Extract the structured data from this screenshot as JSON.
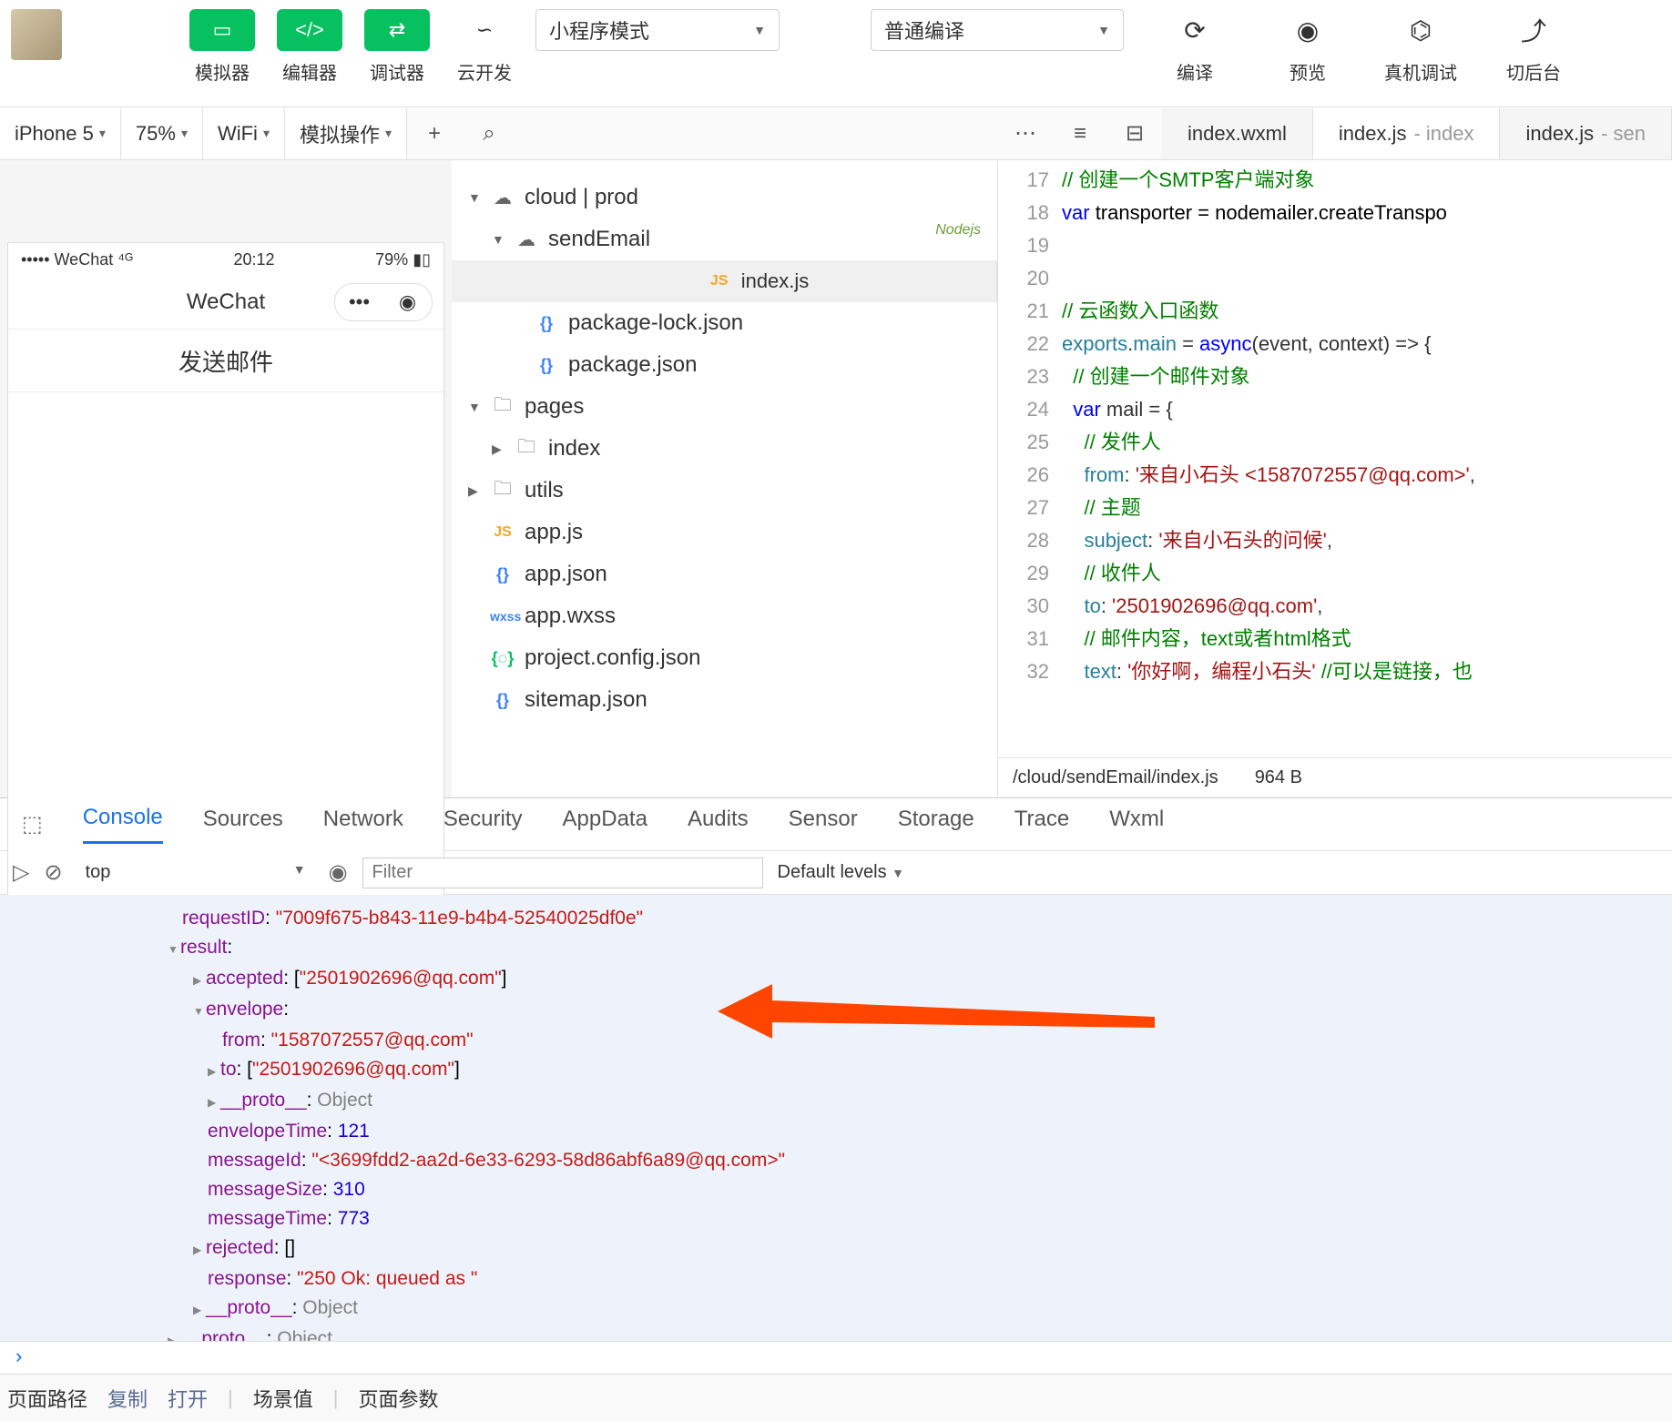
{
  "toolbar": {
    "simulator_label": "模拟器",
    "editor_label": "编辑器",
    "debugger_label": "调试器",
    "cloud_label": "云开发",
    "mode_select": "小程序模式",
    "compile_select": "普通编译",
    "compile_label": "编译",
    "preview_label": "预览",
    "remote_label": "真机调试",
    "background_label": "切后台"
  },
  "secondbar": {
    "device": "iPhone 5",
    "zoom": "75%",
    "network": "WiFi",
    "mock": "模拟操作",
    "tabs": [
      {
        "name": "index.wxml",
        "ext": ""
      },
      {
        "name": "index.js",
        "ext": "- index"
      },
      {
        "name": "index.js",
        "ext": "- sen"
      }
    ]
  },
  "simulator": {
    "carrier": "WeChat",
    "time": "20:12",
    "battery": "79%",
    "nav_title": "WeChat",
    "button": "发送邮件"
  },
  "tree": {
    "cloud": "cloud | prod",
    "sendEmail": "sendEmail",
    "nodejs": "Nodejs",
    "indexjs": "index.js",
    "pkglock": "package-lock.json",
    "pkg": "package.json",
    "pages": "pages",
    "index": "index",
    "utils": "utils",
    "appjs": "app.js",
    "appjson": "app.json",
    "appwxss": "app.wxss",
    "projcfg": "project.config.json",
    "sitemap": "sitemap.json"
  },
  "code": {
    "lines": [
      {
        "n": 17,
        "html": "<span class='k-green'>// 创建一个SMTP客户端对象</span>"
      },
      {
        "n": 18,
        "html": "<span class='k-blue'>var</span> <span class='k-black'>transporter = nodemailer.createTranspo</span>"
      },
      {
        "n": 19,
        "html": ""
      },
      {
        "n": 20,
        "html": ""
      },
      {
        "n": 21,
        "html": "<span class='k-green'>// 云函数入口函数</span>"
      },
      {
        "n": 22,
        "html": "<span class='k-teal'>exports</span>.<span class='k-teal'>main</span> = <span class='k-blue'>async</span>(event, context) =&gt; {"
      },
      {
        "n": 23,
        "html": "  <span class='k-green'>// 创建一个邮件对象</span>"
      },
      {
        "n": 24,
        "html": "  <span class='k-blue'>var</span> mail = {"
      },
      {
        "n": 25,
        "html": "    <span class='k-green'>// 发件人</span>"
      },
      {
        "n": 26,
        "html": "    <span class='k-teal'>from</span>: <span class='k-red'>'来自小石头 &lt;1587072557@qq.com&gt;'</span>,"
      },
      {
        "n": 27,
        "html": "    <span class='k-green'>// 主题</span>"
      },
      {
        "n": 28,
        "html": "    <span class='k-teal'>subject</span>: <span class='k-red'>'来自小石头的问候'</span>,"
      },
      {
        "n": 29,
        "html": "    <span class='k-green'>// 收件人</span>"
      },
      {
        "n": 30,
        "html": "    <span class='k-teal'>to</span>: <span class='k-red'>'2501902696@qq.com'</span>,"
      },
      {
        "n": 31,
        "html": "    <span class='k-green'>// 邮件内容，text或者html格式</span>"
      },
      {
        "n": 32,
        "html": "    <span class='k-teal'>text</span>: <span class='k-red'>'你好啊，编程小石头'</span> <span class='k-green'>//可以是链接，也</span>"
      }
    ],
    "path": "/cloud/sendEmail/index.js",
    "size": "964 B"
  },
  "devtools": {
    "tabs": [
      "Console",
      "Sources",
      "Network",
      "Security",
      "AppData",
      "Audits",
      "Sensor",
      "Storage",
      "Trace",
      "Wxml"
    ],
    "context": "top",
    "filter_ph": "Filter",
    "levels": "Default levels",
    "log": {
      "requestID": "7009f675-b843-11e9-b4b4-52540025df0e",
      "accepted": "2501902696@qq.com",
      "env_from": "1587072557@qq.com",
      "env_to": "2501902696@qq.com",
      "proto": "Object",
      "envelopeTime": "121",
      "messageId": "<3699fdd2-aa2d-6e33-6293-58d86abf6a89@qq.com>",
      "messageSize": "310",
      "messageTime": "773",
      "rejected": "[]",
      "response": "250 Ok: queued as "
    }
  },
  "footer": {
    "route": "页面路径",
    "copy": "复制",
    "open": "打开",
    "scene": "场景值",
    "params": "页面参数"
  }
}
